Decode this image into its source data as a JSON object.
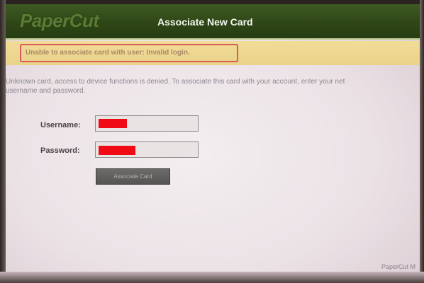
{
  "header": {
    "logo_text": "PaperCut",
    "title": "Associate New Card"
  },
  "error": {
    "message": "Unable to associate card with user: Invalid login."
  },
  "intro": {
    "line1": "Unknown card, access to device functions is denied. To associate this card with your account, enter your net",
    "line2": "username and password."
  },
  "form": {
    "username_label": "Username:",
    "username_value": "",
    "password_label": "Password:",
    "password_value": "",
    "submit_label": "Associate Card"
  },
  "footer": {
    "brand": "PaperCut M"
  },
  "colors": {
    "header_green": "#2d4516",
    "error_bg": "#ead28a",
    "error_border": "#d95b58",
    "redaction_red": "#f00a16"
  }
}
